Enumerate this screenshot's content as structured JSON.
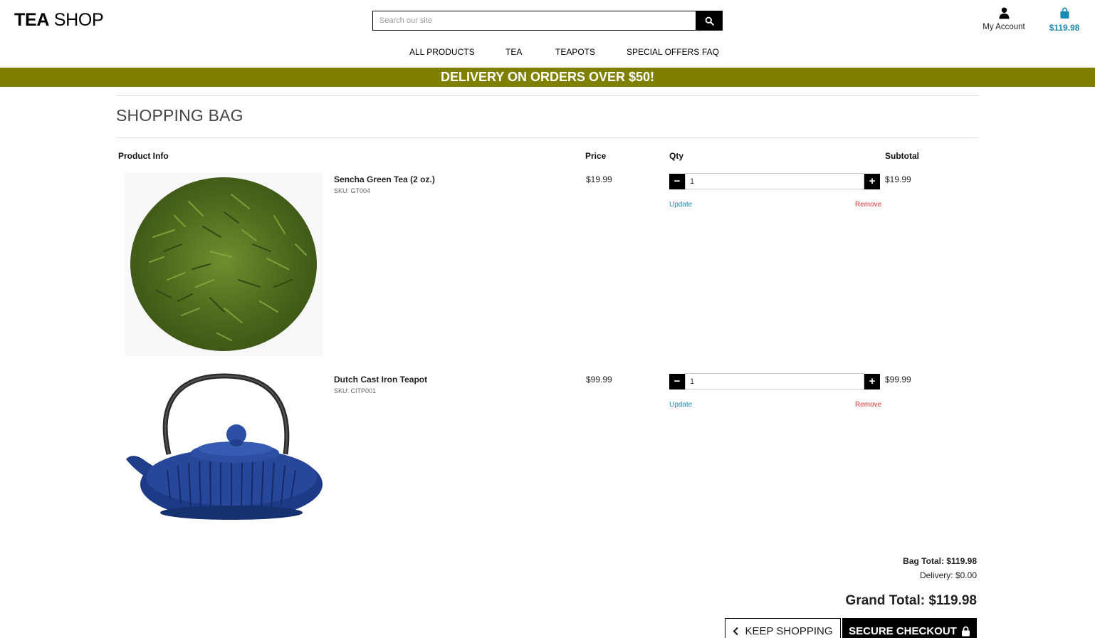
{
  "header": {
    "logo_bold": "TEA",
    "logo_rest": " SHOP",
    "search_placeholder": "Search our site",
    "account_label": "My Account",
    "bag_total": "$119.98"
  },
  "nav": [
    "ALL PRODUCTS",
    "TEA",
    "TEAPOTS",
    "SPECIAL OFFERS",
    "FAQ"
  ],
  "banner": "DELIVERY ON ORDERS OVER $50!",
  "page_title": "SHOPPING BAG",
  "table_headers": {
    "product": "Product Info",
    "price": "Price",
    "qty": "Qty",
    "subtotal": "Subtotal"
  },
  "items": [
    {
      "name": "Sencha Green Tea (2 oz.)",
      "sku": "SKU: GT004",
      "price": "$19.99",
      "qty": "1",
      "subtotal": "$19.99",
      "update": "Update",
      "remove": "Remove"
    },
    {
      "name": "Dutch Cast Iron Teapot",
      "sku": "SKU: CITP001",
      "price": "$99.99",
      "qty": "1",
      "subtotal": "$99.99",
      "update": "Update",
      "remove": "Remove"
    }
  ],
  "totals": {
    "bag_total": "Bag Total: $119.98",
    "delivery": "Delivery: $0.00",
    "grand_total": "Grand Total: $119.98"
  },
  "buttons": {
    "keep_shopping": "KEEP SHOPPING",
    "secure_checkout": "SECURE CHECKOUT"
  },
  "colors": {
    "banner": "#808000",
    "accent": "#1a8ab1",
    "remove": "#dd3333"
  }
}
